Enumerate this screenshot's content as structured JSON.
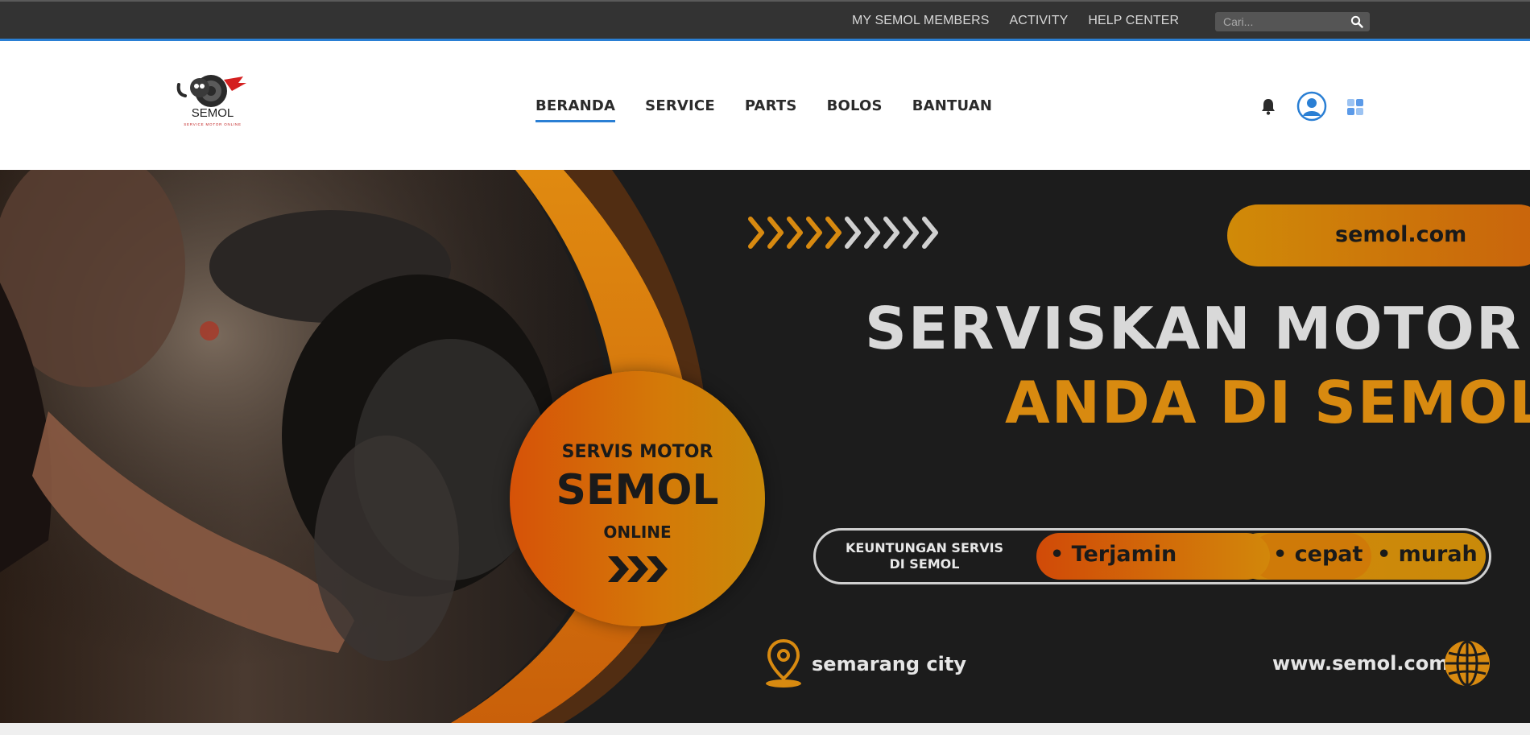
{
  "topbar": {
    "links": [
      "MY SEMOL MEMBERS",
      "ACTIVITY",
      "HELP CENTER"
    ],
    "search_placeholder": "Cari..."
  },
  "header": {
    "logo_text": "SEMOL",
    "logo_subtext": "SERVICE MOTOR ONLINE",
    "nav": [
      "BERANDA",
      "SERVICE",
      "PARTS",
      "BOLOS",
      "BANTUAN"
    ],
    "active_nav": "BERANDA"
  },
  "hero": {
    "domain": "semol.com",
    "headline_line1": "SERVISKAN MOTOR",
    "headline_line2": "ANDA DI SEMOL",
    "circle_line1": "SERVIS MOTOR",
    "circle_line2": "SEMOL",
    "circle_line3": "ONLINE",
    "benefit_label": "KEUNTUNGAN SERVIS DI SEMOL",
    "benefits": [
      "• Terjamin",
      "• cepat",
      "• murah"
    ],
    "location": "semarang city",
    "website": "www.semol.com"
  },
  "colors": {
    "accent_blue": "#2a7fd4",
    "orange": "#d88a10",
    "dark": "#1c1c1c"
  },
  "icons": [
    "search-icon",
    "bell-icon",
    "user-avatar-icon",
    "apps-grid-icon",
    "location-pin-icon",
    "globe-icon",
    "chevron-arrows-icon"
  ]
}
